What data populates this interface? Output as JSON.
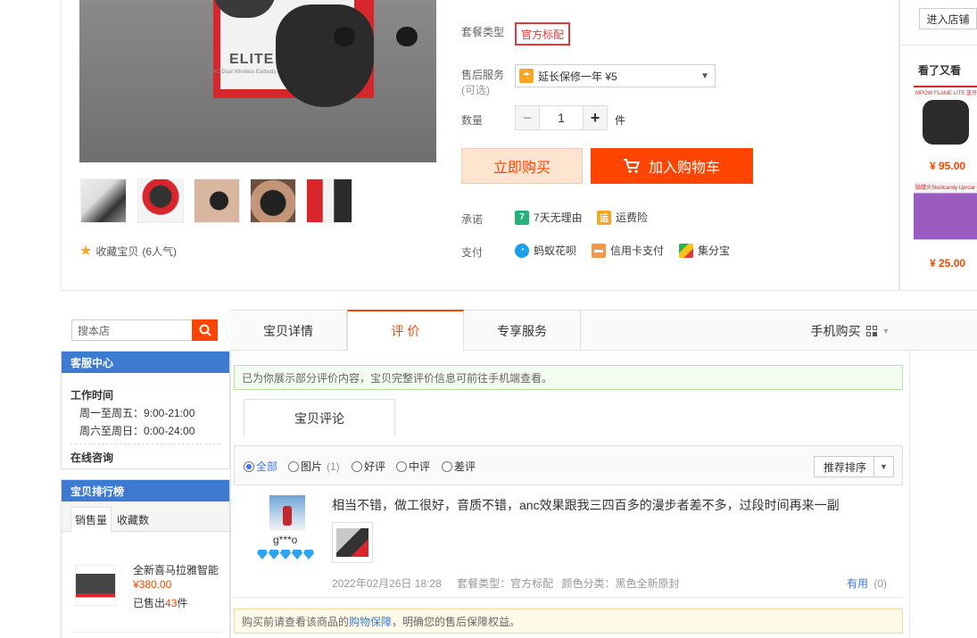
{
  "product": {
    "image_brand": "ELITE",
    "image_subtitle": "ANC Dual Wireless Earbuds",
    "favorite": {
      "label": "收藏宝贝",
      "count_text": "(6人气)"
    }
  },
  "options": {
    "package_label": "套餐类型",
    "package_value": "官方标配",
    "service_label": "售后服务",
    "service_optional": "(可选)",
    "service_value": "延长保修一年 ¥5",
    "quantity_label": "数量",
    "quantity_value": "1",
    "quantity_unit": "件",
    "buy_now": "立即购买",
    "add_to_cart": "加入购物车",
    "promise_label": "承诺",
    "promises": [
      {
        "icon": "7",
        "text": "7天无理由"
      },
      {
        "icon": "运",
        "text": "运费险"
      }
    ],
    "pay_label": "支付",
    "payments": [
      {
        "text": "蚂蚁花呗"
      },
      {
        "text": "信用卡支付"
      },
      {
        "text": "集分宝"
      }
    ]
  },
  "right_rail": {
    "shop_button": "进入店铺",
    "seen_title": "看了又看",
    "items": [
      {
        "caption": "MPOW FLAME LITE 蓝牙耳机",
        "price": "¥ 95.00"
      },
      {
        "caption": "骷髅头Skullcandy Uproar",
        "price": "¥ 25.00"
      }
    ]
  },
  "sidebar": {
    "search_placeholder": "搜本店",
    "service_title": "客服中心",
    "work_time_title": "工作时间",
    "weekday_hours": "周一至周五：9:00-21:00",
    "weekend_hours": "周六至周日：0:00-24:00",
    "online_consult": "在线咨询",
    "ranking_title": "宝贝排行榜",
    "ranking_tabs": [
      "销售量",
      "收藏数"
    ],
    "ranking_items": [
      {
        "name": "全新喜马拉雅智能",
        "price": "¥380.00",
        "sold_prefix": "已售出",
        "sold_count": "43",
        "sold_suffix": "件"
      }
    ]
  },
  "tabs": {
    "items": [
      "宝贝详情",
      "评 价",
      "专享服务"
    ],
    "active": "评 价",
    "mobile_buy": "手机购买"
  },
  "reviews": {
    "notice": "已为你展示部分评价内容，宝贝完整评价信息可前往手机端查看。",
    "sub_tab": "宝贝评论",
    "filters": [
      {
        "label": "全部",
        "selected": true
      },
      {
        "label": "图片",
        "count": "(1)",
        "selected": false
      },
      {
        "label": "好评",
        "selected": false
      },
      {
        "label": "中评",
        "selected": false
      },
      {
        "label": "差评",
        "selected": false
      }
    ],
    "sort_label": "推荐排序",
    "list": [
      {
        "user": "g***o",
        "level_icons": 5,
        "text": "相当不错，做工很好，音质不错，anc效果跟我三四百多的漫步者差不多，过段时间再来一副",
        "date": "2022年02月26日 18:28",
        "package": "套餐类型：官方标配",
        "color": "颜色分类：黑色全新原封",
        "useful_label": "有用",
        "useful_count": "(0)"
      }
    ],
    "footer_notice_prefix": "购买前请查看该商品的",
    "footer_notice_link": "购物保障",
    "footer_notice_suffix": "，明确您的售后保障权益。"
  },
  "colors": {
    "accent": "#ff4400",
    "blue": "#3d7ad0",
    "red_border": "#e4393c"
  }
}
